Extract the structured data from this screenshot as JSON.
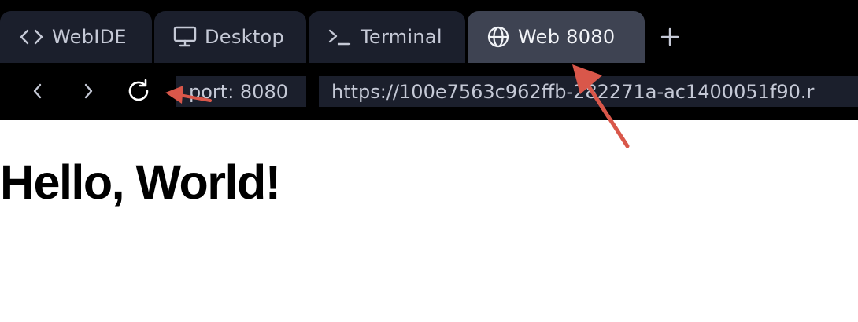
{
  "tabs": [
    {
      "label": "WebIDE",
      "icon": "code-icon",
      "active": false
    },
    {
      "label": "Desktop",
      "icon": "monitor-icon",
      "active": false
    },
    {
      "label": "Terminal",
      "icon": "terminal-icon",
      "active": false
    },
    {
      "label": "Web 8080",
      "icon": "globe-icon",
      "active": true
    }
  ],
  "add_tab_icon": "plus-icon",
  "nav": {
    "back_icon": "chevron-left-icon",
    "forward_icon": "chevron-right-icon",
    "reload_icon": "reload-icon",
    "port_label": "port: 8080",
    "url": "https://100e7563c962ffb-282271a-ac1400051f90.r"
  },
  "page": {
    "heading": "Hello, World!"
  },
  "annotations": {
    "arrow_color": "#d9574a"
  },
  "colors": {
    "tab_bg": "#1b1f2c",
    "tab_active_bg": "#3e4352",
    "bar_bg": "#000000",
    "text": "#c5c9d6"
  }
}
